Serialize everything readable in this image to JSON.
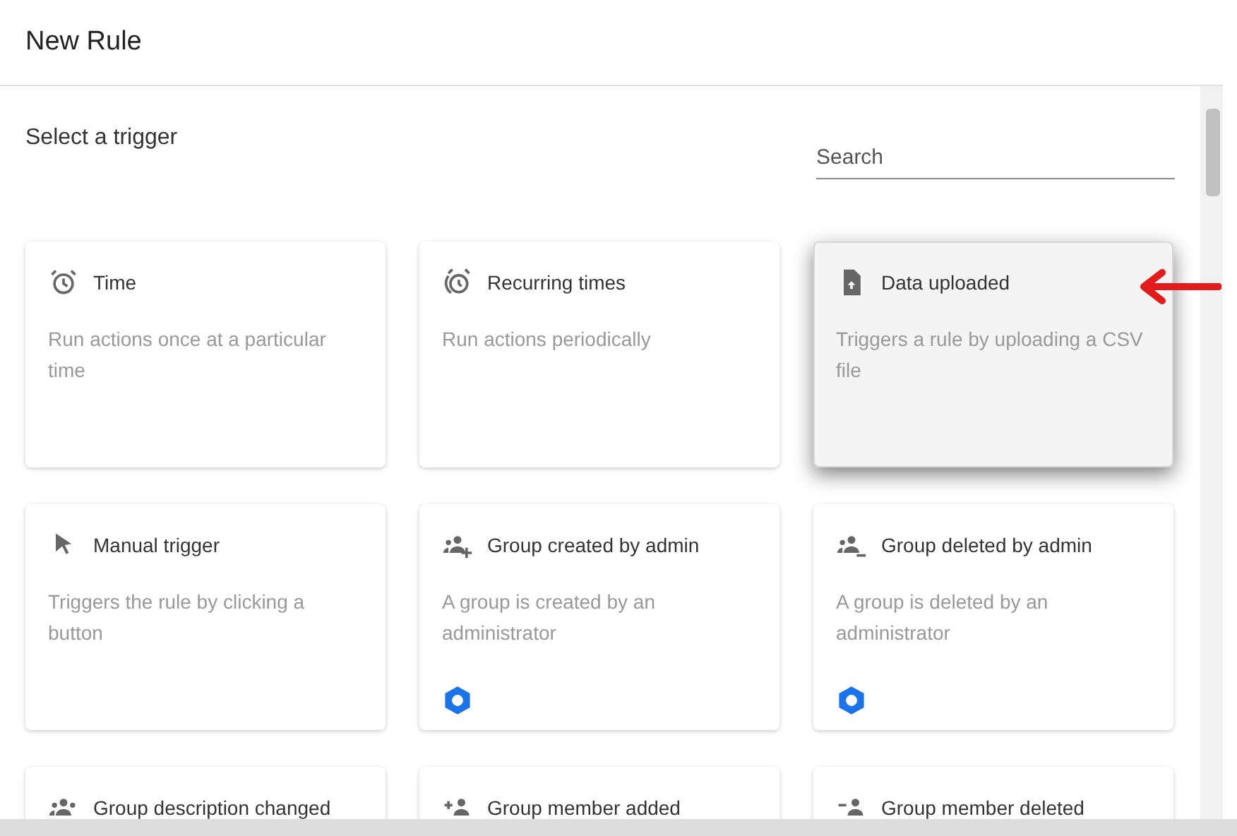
{
  "dialog": {
    "title": "New Rule"
  },
  "section_title": "Select a trigger",
  "search": {
    "placeholder": "Search"
  },
  "triggers": [
    {
      "title": "Time",
      "description": "Run actions once at a particular time",
      "kind": "alarm",
      "selected": false,
      "admin_badge": false
    },
    {
      "title": "Recurring times",
      "description": "Run actions periodically",
      "kind": "recurring",
      "selected": false,
      "admin_badge": false
    },
    {
      "title": "Data uploaded",
      "description": "Triggers a rule by uploading a CSV file",
      "kind": "upload",
      "selected": true,
      "admin_badge": false
    },
    {
      "title": "Manual trigger",
      "description": "Triggers the rule by clicking a button",
      "kind": "manual",
      "selected": false,
      "admin_badge": false
    },
    {
      "title": "Group created by admin",
      "description": "A group is created by an administrator",
      "kind": "groupadd",
      "selected": false,
      "admin_badge": true
    },
    {
      "title": "Group deleted by admin",
      "description": "A group is deleted by an administrator",
      "kind": "groupremove",
      "selected": false,
      "admin_badge": true
    },
    {
      "title": "Group description changed",
      "kind": "group",
      "selected": false,
      "admin_badge": false
    },
    {
      "title": "Group member added",
      "kind": "memberadd",
      "selected": false,
      "admin_badge": false
    },
    {
      "title": "Group member deleted",
      "kind": "memberremove",
      "selected": false,
      "admin_badge": false
    }
  ]
}
